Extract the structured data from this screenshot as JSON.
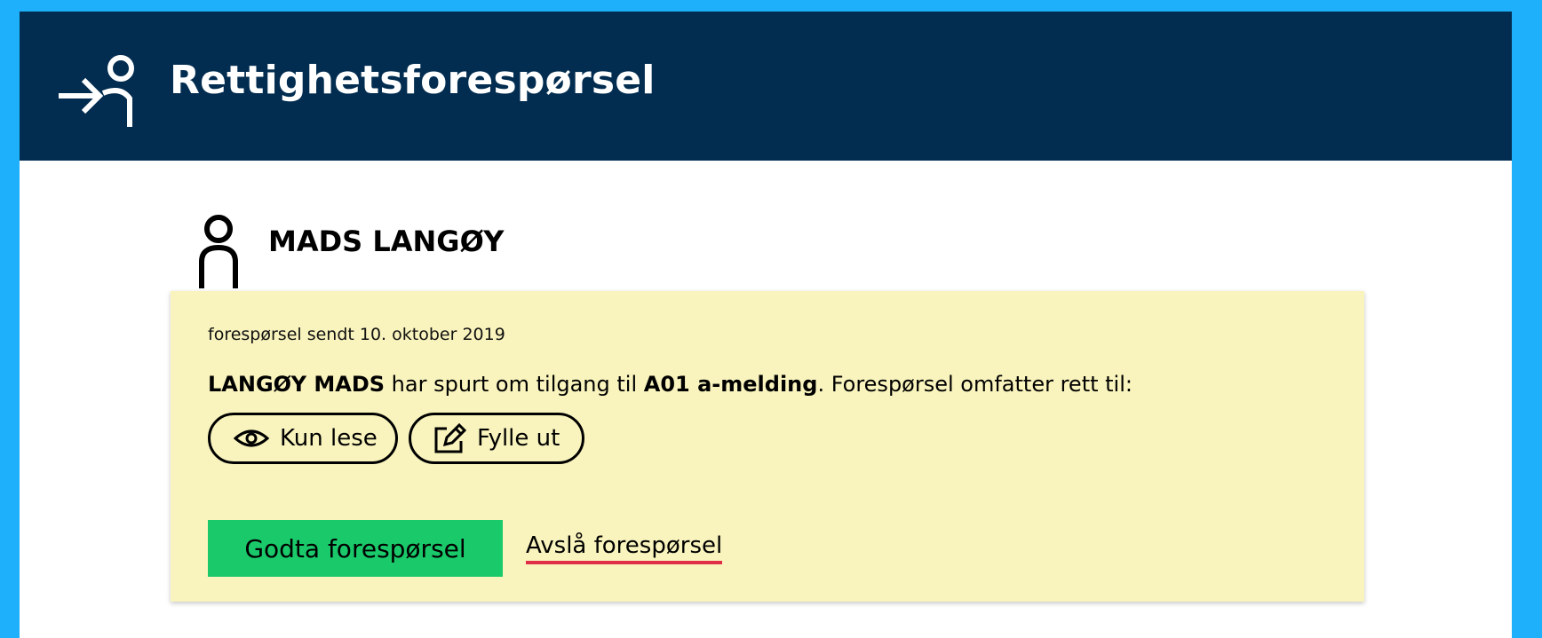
{
  "header": {
    "title": "Rettighetsforespørsel",
    "icon": "person-arrow-icon"
  },
  "person": {
    "name": "MADS LANGØY",
    "icon": "person-icon"
  },
  "request": {
    "date_text": "forespørsel sendt 10. oktober 2019",
    "message": {
      "requester": "LANGØY MADS",
      "middle": " har spurt om tilgang til ",
      "service": "A01 a-melding",
      "suffix": ". Forespørsel omfatter rett til:"
    },
    "rights": [
      {
        "label": "Kun lese",
        "icon": "eye-icon"
      },
      {
        "label": "Fylle ut",
        "icon": "pencil-edit-icon"
      }
    ],
    "accept_label": "Godta forespørsel",
    "reject_label": "Avslå forespørsel"
  },
  "colors": {
    "page_background": "#1eb0fb",
    "header_background": "#022d50",
    "card_background": "#f9f4bd",
    "accept_button": "#1ac96a",
    "reject_underline": "#e02e48"
  }
}
